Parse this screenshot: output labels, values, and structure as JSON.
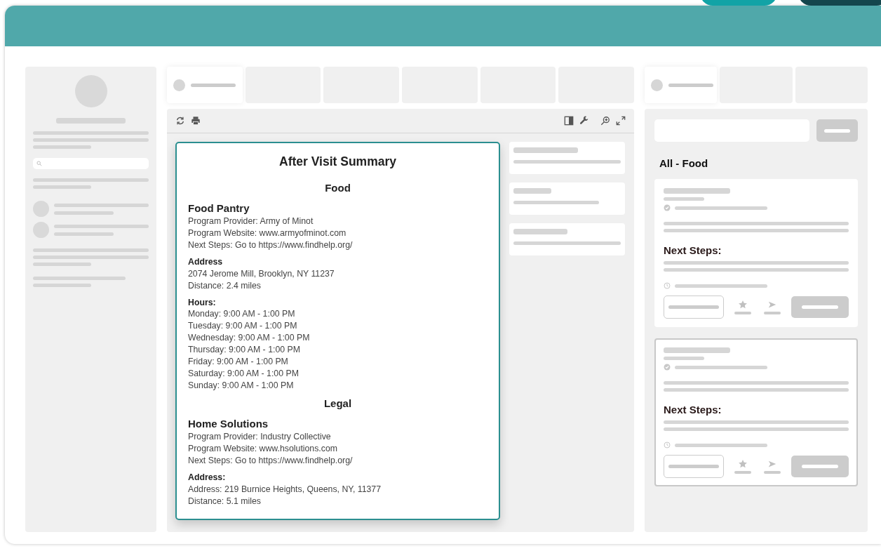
{
  "document": {
    "title": "After Visit Summary",
    "sections": [
      {
        "heading": "Food",
        "programs": [
          {
            "name": "Food Pantry",
            "details": [
              "Program Provider: Army of Minot",
              "Program Website: www.armyofminot.com",
              "Next Steps: Go to https://www.findhelp.org/"
            ],
            "address_label": "Address",
            "address_lines": [
              "2074 Jerome Mill, Brooklyn, NY 11237",
              "Distance: 2.4 miles"
            ],
            "hours_label": "Hours:",
            "hours": [
              "Monday: 9:00 AM - 1:00 PM",
              "Tuesday: 9:00 AM - 1:00 PM",
              "Wednesday: 9:00 AM - 1:00 PM",
              "Thursday: 9:00 AM - 1:00 PM",
              "Friday: 9:00 AM - 1:00 PM",
              "Saturday: 9:00 AM - 1:00 PM",
              "Sunday: 9:00 AM - 1:00 PM"
            ]
          }
        ]
      },
      {
        "heading": "Legal",
        "programs": [
          {
            "name": "Home Solutions",
            "details": [
              "Program Provider: Industry Collective",
              "Program Website: www.hsolutions.com",
              "Next Steps: Go to https://www.findhelp.org/"
            ],
            "address_label": "Address:",
            "address_lines": [
              "Address: 219 Burnice Heights, Queens, NY, 11377",
              "Distance: 5.1 miles"
            ]
          }
        ]
      }
    ]
  },
  "middle_tabs": [
    {
      "selected": true
    },
    {
      "selected": false
    },
    {
      "selected": false
    },
    {
      "selected": false
    },
    {
      "selected": false
    },
    {
      "selected": false
    }
  ],
  "right_tabs": [
    {
      "selected": true
    },
    {
      "selected": false
    },
    {
      "selected": false
    }
  ],
  "results": {
    "heading": "All - Food",
    "cards": [
      {
        "next_steps_label": "Next Steps:",
        "selected": false
      },
      {
        "next_steps_label": "Next Steps:",
        "selected": true
      }
    ]
  }
}
